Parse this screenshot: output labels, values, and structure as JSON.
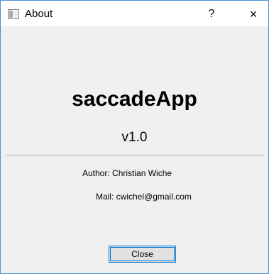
{
  "window": {
    "title": "About",
    "help_glyph": "?",
    "close_glyph": "×",
    "app_icon": "window-app-icon",
    "accent_color": "#0078d7",
    "border_color": "#4a90d9",
    "background_color": "#f0f0f0"
  },
  "about": {
    "app_name": "saccadeApp",
    "version": "v1.0",
    "author_line": "Author: Christian Wiche",
    "mail_line": "Mail: cwichel@gmail.com"
  },
  "buttons": {
    "close_label": "Close"
  }
}
